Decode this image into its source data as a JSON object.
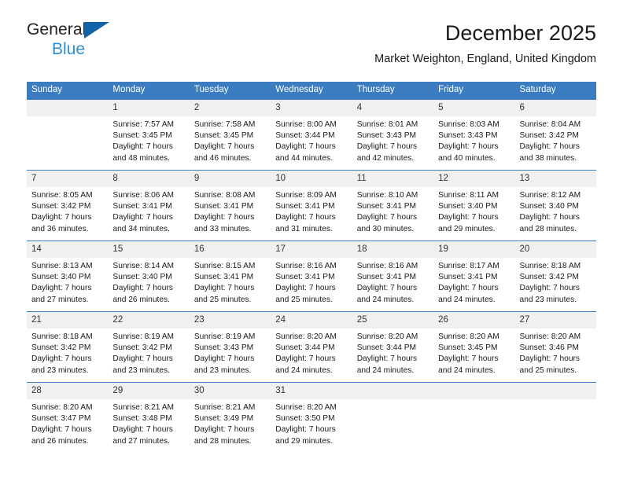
{
  "brand": {
    "line1": "General",
    "line2": "Blue",
    "triangle_color": "#1263a8",
    "blue_text_color": "#2a8fd4"
  },
  "header": {
    "title": "December 2025",
    "subtitle": "Market Weighton, England, United Kingdom"
  },
  "theme": {
    "header_row_bg": "#3b7dc0",
    "header_row_text": "#ffffff",
    "daynum_bg": "#f0f0f0",
    "row_border": "#3b7dc0"
  },
  "weekdays": [
    "Sunday",
    "Monday",
    "Tuesday",
    "Wednesday",
    "Thursday",
    "Friday",
    "Saturday"
  ],
  "weeks": [
    [
      {
        "day": "",
        "sunrise": "",
        "sunset": "",
        "daylight1": "",
        "daylight2": ""
      },
      {
        "day": "1",
        "sunrise": "Sunrise: 7:57 AM",
        "sunset": "Sunset: 3:45 PM",
        "daylight1": "Daylight: 7 hours",
        "daylight2": "and 48 minutes."
      },
      {
        "day": "2",
        "sunrise": "Sunrise: 7:58 AM",
        "sunset": "Sunset: 3:45 PM",
        "daylight1": "Daylight: 7 hours",
        "daylight2": "and 46 minutes."
      },
      {
        "day": "3",
        "sunrise": "Sunrise: 8:00 AM",
        "sunset": "Sunset: 3:44 PM",
        "daylight1": "Daylight: 7 hours",
        "daylight2": "and 44 minutes."
      },
      {
        "day": "4",
        "sunrise": "Sunrise: 8:01 AM",
        "sunset": "Sunset: 3:43 PM",
        "daylight1": "Daylight: 7 hours",
        "daylight2": "and 42 minutes."
      },
      {
        "day": "5",
        "sunrise": "Sunrise: 8:03 AM",
        "sunset": "Sunset: 3:43 PM",
        "daylight1": "Daylight: 7 hours",
        "daylight2": "and 40 minutes."
      },
      {
        "day": "6",
        "sunrise": "Sunrise: 8:04 AM",
        "sunset": "Sunset: 3:42 PM",
        "daylight1": "Daylight: 7 hours",
        "daylight2": "and 38 minutes."
      }
    ],
    [
      {
        "day": "7",
        "sunrise": "Sunrise: 8:05 AM",
        "sunset": "Sunset: 3:42 PM",
        "daylight1": "Daylight: 7 hours",
        "daylight2": "and 36 minutes."
      },
      {
        "day": "8",
        "sunrise": "Sunrise: 8:06 AM",
        "sunset": "Sunset: 3:41 PM",
        "daylight1": "Daylight: 7 hours",
        "daylight2": "and 34 minutes."
      },
      {
        "day": "9",
        "sunrise": "Sunrise: 8:08 AM",
        "sunset": "Sunset: 3:41 PM",
        "daylight1": "Daylight: 7 hours",
        "daylight2": "and 33 minutes."
      },
      {
        "day": "10",
        "sunrise": "Sunrise: 8:09 AM",
        "sunset": "Sunset: 3:41 PM",
        "daylight1": "Daylight: 7 hours",
        "daylight2": "and 31 minutes."
      },
      {
        "day": "11",
        "sunrise": "Sunrise: 8:10 AM",
        "sunset": "Sunset: 3:41 PM",
        "daylight1": "Daylight: 7 hours",
        "daylight2": "and 30 minutes."
      },
      {
        "day": "12",
        "sunrise": "Sunrise: 8:11 AM",
        "sunset": "Sunset: 3:40 PM",
        "daylight1": "Daylight: 7 hours",
        "daylight2": "and 29 minutes."
      },
      {
        "day": "13",
        "sunrise": "Sunrise: 8:12 AM",
        "sunset": "Sunset: 3:40 PM",
        "daylight1": "Daylight: 7 hours",
        "daylight2": "and 28 minutes."
      }
    ],
    [
      {
        "day": "14",
        "sunrise": "Sunrise: 8:13 AM",
        "sunset": "Sunset: 3:40 PM",
        "daylight1": "Daylight: 7 hours",
        "daylight2": "and 27 minutes."
      },
      {
        "day": "15",
        "sunrise": "Sunrise: 8:14 AM",
        "sunset": "Sunset: 3:40 PM",
        "daylight1": "Daylight: 7 hours",
        "daylight2": "and 26 minutes."
      },
      {
        "day": "16",
        "sunrise": "Sunrise: 8:15 AM",
        "sunset": "Sunset: 3:41 PM",
        "daylight1": "Daylight: 7 hours",
        "daylight2": "and 25 minutes."
      },
      {
        "day": "17",
        "sunrise": "Sunrise: 8:16 AM",
        "sunset": "Sunset: 3:41 PM",
        "daylight1": "Daylight: 7 hours",
        "daylight2": "and 25 minutes."
      },
      {
        "day": "18",
        "sunrise": "Sunrise: 8:16 AM",
        "sunset": "Sunset: 3:41 PM",
        "daylight1": "Daylight: 7 hours",
        "daylight2": "and 24 minutes."
      },
      {
        "day": "19",
        "sunrise": "Sunrise: 8:17 AM",
        "sunset": "Sunset: 3:41 PM",
        "daylight1": "Daylight: 7 hours",
        "daylight2": "and 24 minutes."
      },
      {
        "day": "20",
        "sunrise": "Sunrise: 8:18 AM",
        "sunset": "Sunset: 3:42 PM",
        "daylight1": "Daylight: 7 hours",
        "daylight2": "and 23 minutes."
      }
    ],
    [
      {
        "day": "21",
        "sunrise": "Sunrise: 8:18 AM",
        "sunset": "Sunset: 3:42 PM",
        "daylight1": "Daylight: 7 hours",
        "daylight2": "and 23 minutes."
      },
      {
        "day": "22",
        "sunrise": "Sunrise: 8:19 AM",
        "sunset": "Sunset: 3:42 PM",
        "daylight1": "Daylight: 7 hours",
        "daylight2": "and 23 minutes."
      },
      {
        "day": "23",
        "sunrise": "Sunrise: 8:19 AM",
        "sunset": "Sunset: 3:43 PM",
        "daylight1": "Daylight: 7 hours",
        "daylight2": "and 23 minutes."
      },
      {
        "day": "24",
        "sunrise": "Sunrise: 8:20 AM",
        "sunset": "Sunset: 3:44 PM",
        "daylight1": "Daylight: 7 hours",
        "daylight2": "and 24 minutes."
      },
      {
        "day": "25",
        "sunrise": "Sunrise: 8:20 AM",
        "sunset": "Sunset: 3:44 PM",
        "daylight1": "Daylight: 7 hours",
        "daylight2": "and 24 minutes."
      },
      {
        "day": "26",
        "sunrise": "Sunrise: 8:20 AM",
        "sunset": "Sunset: 3:45 PM",
        "daylight1": "Daylight: 7 hours",
        "daylight2": "and 24 minutes."
      },
      {
        "day": "27",
        "sunrise": "Sunrise: 8:20 AM",
        "sunset": "Sunset: 3:46 PM",
        "daylight1": "Daylight: 7 hours",
        "daylight2": "and 25 minutes."
      }
    ],
    [
      {
        "day": "28",
        "sunrise": "Sunrise: 8:20 AM",
        "sunset": "Sunset: 3:47 PM",
        "daylight1": "Daylight: 7 hours",
        "daylight2": "and 26 minutes."
      },
      {
        "day": "29",
        "sunrise": "Sunrise: 8:21 AM",
        "sunset": "Sunset: 3:48 PM",
        "daylight1": "Daylight: 7 hours",
        "daylight2": "and 27 minutes."
      },
      {
        "day": "30",
        "sunrise": "Sunrise: 8:21 AM",
        "sunset": "Sunset: 3:49 PM",
        "daylight1": "Daylight: 7 hours",
        "daylight2": "and 28 minutes."
      },
      {
        "day": "31",
        "sunrise": "Sunrise: 8:20 AM",
        "sunset": "Sunset: 3:50 PM",
        "daylight1": "Daylight: 7 hours",
        "daylight2": "and 29 minutes."
      },
      {
        "day": "",
        "sunrise": "",
        "sunset": "",
        "daylight1": "",
        "daylight2": ""
      },
      {
        "day": "",
        "sunrise": "",
        "sunset": "",
        "daylight1": "",
        "daylight2": ""
      },
      {
        "day": "",
        "sunrise": "",
        "sunset": "",
        "daylight1": "",
        "daylight2": ""
      }
    ]
  ]
}
